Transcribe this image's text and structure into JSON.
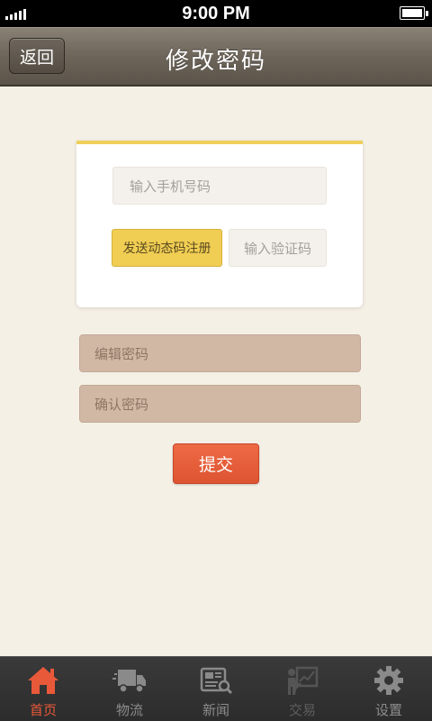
{
  "status_bar": {
    "time": "9:00 PM"
  },
  "nav": {
    "back_label": "返回",
    "title": "修改密码"
  },
  "form": {
    "phone_placeholder": "输入手机号码",
    "send_code_label": "发送动态码注册",
    "code_placeholder": "输入验证码",
    "edit_password_placeholder": "编辑密码",
    "confirm_password_placeholder": "确认密码",
    "submit_label": "提交"
  },
  "tabs": [
    {
      "label": "首页",
      "icon": "home-icon",
      "active": true
    },
    {
      "label": "物流",
      "icon": "truck-icon",
      "active": false
    },
    {
      "label": "新闻",
      "icon": "newspaper-icon",
      "active": false
    },
    {
      "label": "交易",
      "icon": "chart-icon",
      "active": false
    },
    {
      "label": "设置",
      "icon": "gear-icon",
      "active": false
    }
  ],
  "colors": {
    "accent": "#e8593a",
    "highlight": "#efcf5a",
    "field": "#d1b8a5"
  }
}
